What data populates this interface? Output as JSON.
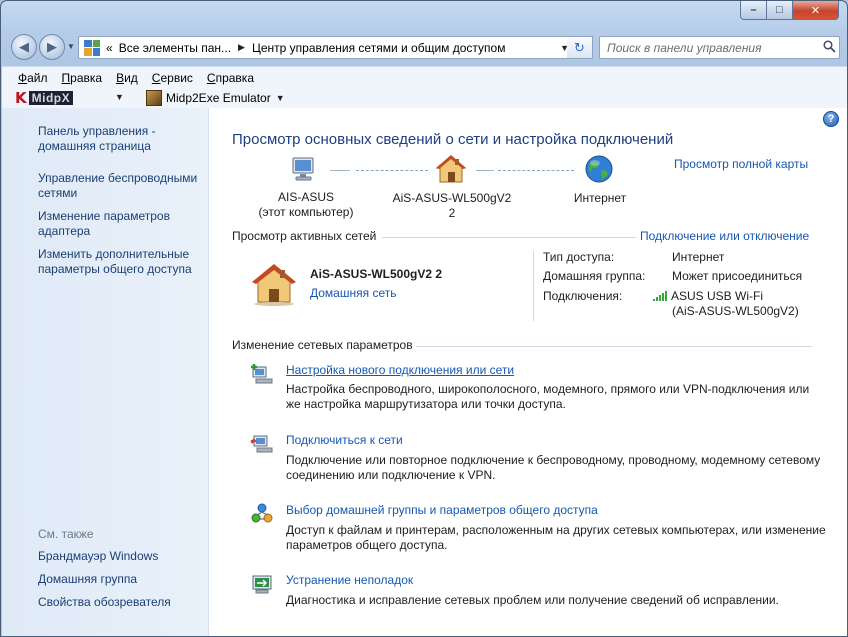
{
  "window": {
    "controls": {
      "minimize": "–",
      "maximize": "□",
      "close": "✕"
    }
  },
  "nav": {
    "back_glyph": "◀",
    "forward_glyph": "▶",
    "address": {
      "overflow": "«",
      "crumbs": [
        "Все элементы пан...",
        "Центр управления сетями и общим доступом"
      ],
      "separator": "▶",
      "dropdown": "▼"
    },
    "refresh_glyph": "↻",
    "search_placeholder": "Поиск в панели управления",
    "search_icon": "search-icon"
  },
  "menubar": {
    "items": [
      {
        "key": "Ф",
        "rest": "айл"
      },
      {
        "key": "П",
        "rest": "равка"
      },
      {
        "key": "В",
        "rest": "ид"
      },
      {
        "key": "С",
        "rest": "ервис"
      },
      {
        "key": "С",
        "rest": "правка"
      }
    ]
  },
  "toolbar": {
    "midp_k": "K",
    "midp_text": "MidpX",
    "midp_caret": "▼",
    "emulator_label": "Midp2Exe Emulator",
    "emulator_caret": "▼"
  },
  "sidebar": {
    "links": [
      "Панель управления - домашняя страница",
      "Управление беспроводными сетями",
      "Изменение параметров адаптера",
      "Изменить дополнительные параметры общего доступа"
    ],
    "see_also_title": "См. также",
    "see_also": [
      "Брандмауэр Windows",
      "Домашняя группа",
      "Свойства обозревателя"
    ]
  },
  "main": {
    "help_glyph": "?",
    "title": "Просмотр основных сведений о сети и настройка подключений",
    "full_map_link": "Просмотр полной карты",
    "map": {
      "computer_name": "AIS-ASUS",
      "computer_sub": "(этот компьютер)",
      "router_name": "AiS-ASUS-WL500gV2  2",
      "internet": "Интернет"
    },
    "active_header": "Просмотр активных сетей",
    "connect_link": "Подключение или отключение",
    "network": {
      "name": "AiS-ASUS-WL500gV2  2",
      "type": "Домашняя сеть",
      "access_type_label": "Тип доступа:",
      "access_type_value": "Интернет",
      "homegroup_label": "Домашняя группа:",
      "homegroup_value": "Может присоединиться",
      "connections_label": "Подключения:",
      "connection_line1": "ASUS USB Wi-Fi",
      "connection_line2": "(AiS-ASUS-WL500gV2)"
    },
    "change_header": "Изменение сетевых параметров",
    "tasks": [
      {
        "title": "Настройка нового подключения или сети",
        "desc": "Настройка беспроводного, широкополосного, модемного, прямого или VPN-подключения или же настройка маршрутизатора или точки доступа."
      },
      {
        "title": "Подключиться к сети",
        "desc": "Подключение или повторное подключение к беспроводному, проводному, модемному сетевому соединению или подключение к VPN."
      },
      {
        "title": "Выбор домашней группы и параметров общего доступа",
        "desc": "Доступ к файлам и принтерам, расположенным на других сетевых компьютерах, или изменение параметров общего доступа."
      },
      {
        "title": "Устранение неполадок",
        "desc": "Диагностика и исправление сетевых проблем или получение сведений об исправлении."
      }
    ]
  }
}
